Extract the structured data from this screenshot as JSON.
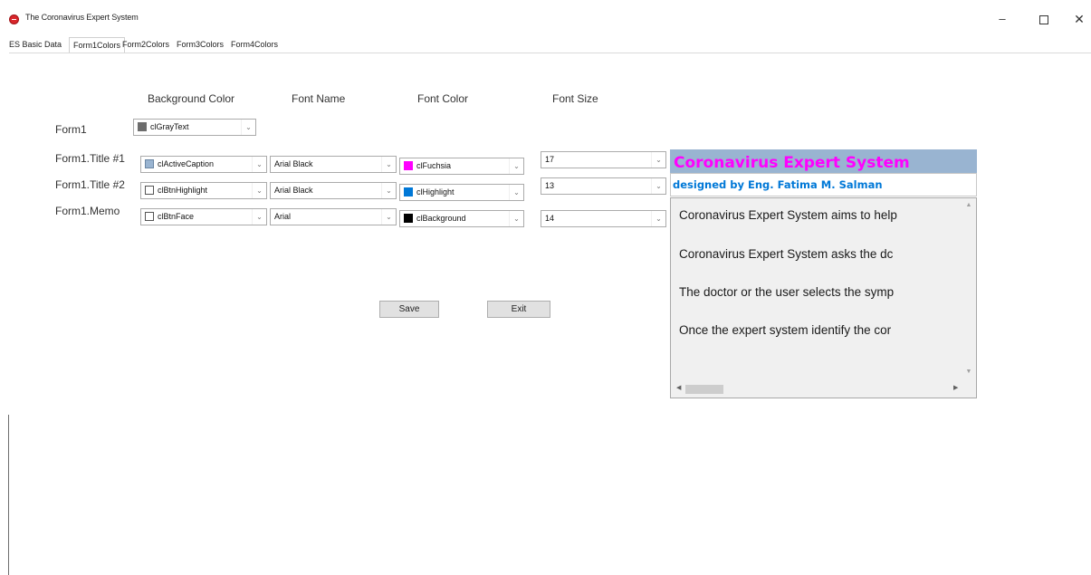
{
  "window": {
    "title": "The Coronavirus Expert System",
    "minimize_glyph": "–",
    "close_glyph": "✕",
    "icon": "app-icon"
  },
  "tabs": [
    {
      "label": "ES Basic Data"
    },
    {
      "label": "Form1Colors",
      "active": true
    },
    {
      "label": "Form2Colors"
    },
    {
      "label": "Form3Colors"
    },
    {
      "label": "Form4Colors"
    }
  ],
  "headers": {
    "background_color": "Background Color",
    "font_name": "Font Name",
    "font_color": "Font Color",
    "font_size": "Font Size"
  },
  "rows": {
    "form1": {
      "label": "Form1",
      "bg": "clGrayText",
      "bg_swatch": "#6d6d6d"
    },
    "title1": {
      "label": "Form1.Title #1",
      "bg": "clActiveCaption",
      "bg_swatch": "#99b4d1",
      "font": "Arial Black",
      "color": "clFuchsia",
      "color_swatch": "#ff00ff",
      "size": "17"
    },
    "title2": {
      "label": "Form1.Title #2",
      "bg": "clBtnHighlight",
      "bg_swatch": "#ffffff",
      "font": "Arial Black",
      "color": "clHighlight",
      "color_swatch": "#0078d7",
      "size": "13"
    },
    "memo": {
      "label": "Form1.Memo",
      "bg": "clBtnFace",
      "bg_swatch": "#ffffff",
      "font": "Arial",
      "color": "clBackground",
      "color_swatch": "#000000",
      "size": "14"
    }
  },
  "dropdown_glyph": "⌄",
  "buttons": {
    "save": "Save",
    "exit": "Exit"
  },
  "preview": {
    "title1": "Coronavirus Expert System",
    "title2": "designed by Eng. Fatima M. Salman",
    "memo_lines": [
      "Coronavirus Expert System aims to help",
      "Coronavirus Expert System asks the dc",
      "The doctor or the user selects the symp",
      "Once the expert system identify the cor"
    ]
  },
  "scroll_glyphs": {
    "up": "▲",
    "down": "▼",
    "left": "◀",
    "right": "▶"
  }
}
